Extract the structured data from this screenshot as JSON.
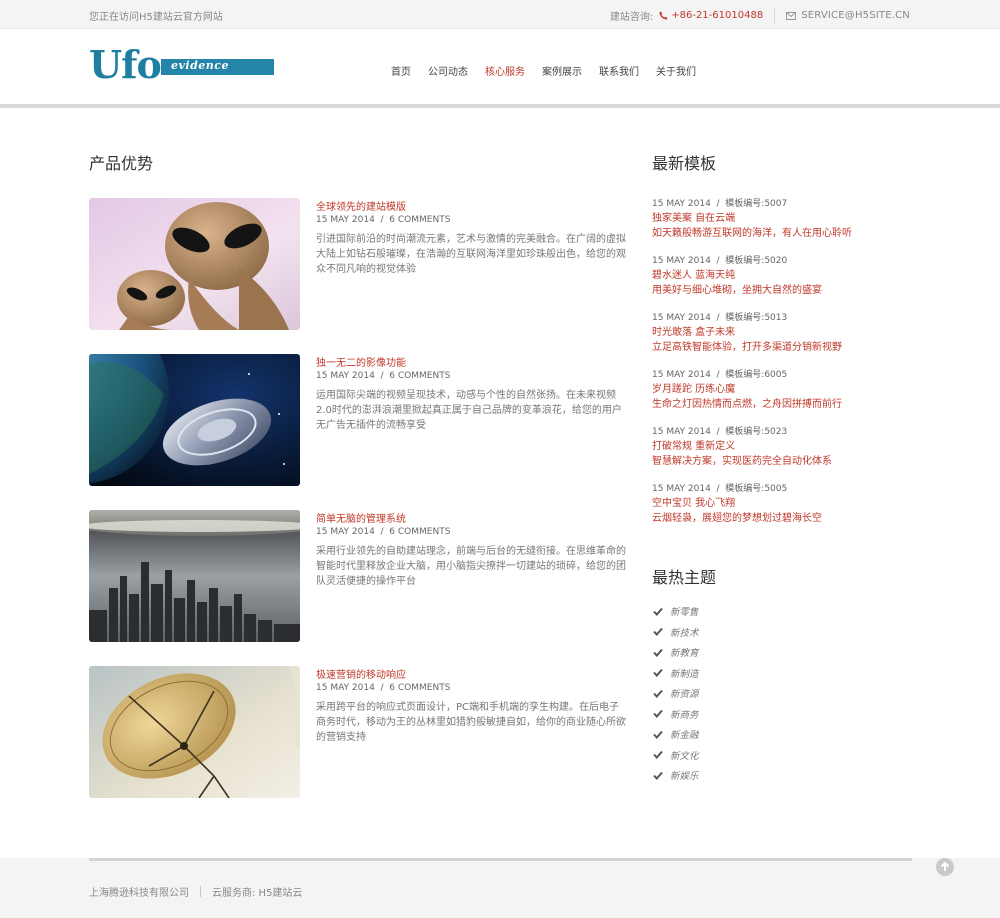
{
  "topbar": {
    "welcome": "您正在访问H5建站云官方网站",
    "consult_label": "建站咨询:",
    "phone": "+86-21-61010488",
    "email": "SERVICE@H5SITE.CN"
  },
  "logo": {
    "main": "Ufo",
    "sub": "evidence"
  },
  "nav": [
    {
      "label": "首页"
    },
    {
      "label": "公司动态"
    },
    {
      "label": "核心服务"
    },
    {
      "label": "案例展示"
    },
    {
      "label": "联系我们"
    },
    {
      "label": "关于我们"
    }
  ],
  "nav_active_index": 2,
  "products": {
    "title": "产品优势",
    "posts": [
      {
        "title": "全球领先的建站模版",
        "date": "15 MAY 2014",
        "comments": "6 COMMENTS",
        "desc": "引进国际前沿的时尚潮流元素，艺术与激情的完美融合。在广阔的虚拟大陆上如钻石般璀璨，在浩瀚的互联网海洋里如珍珠般出色，给您的观众不同凡响的视觉体验",
        "image": "alien-image"
      },
      {
        "title": "独一无二的影像功能",
        "date": "15 MAY 2014",
        "comments": "6 COMMENTS",
        "desc": "运用国际尖端的视频呈现技术，动感与个性的自然张扬。在未来视频2.0时代的澎湃浪潮里掀起真正属于自己品牌的变革浪花，给您的用户无广告无插件的流畅享受",
        "image": "ufo-space-image"
      },
      {
        "title": "简单无脑的管理系统",
        "date": "15 MAY 2014",
        "comments": "6 COMMENTS",
        "desc": "采用行业领先的自助建站理念，前端与后台的无缝衔接。在思维革命的智能时代里释放企业大脑，用小脑指尖撩拌一切建站的琐碎，给您的团队灵活便捷的操作平台",
        "image": "city-image"
      },
      {
        "title": "极速营销的移动响应",
        "date": "15 MAY 2014",
        "comments": "6 COMMENTS",
        "desc": "采用跨平台的响应式页面设计，PC端和手机端的孪生构建。在后电子商务时代，移动为王的丛林里如猎豹般敏捷自如，给你的商业随心所欲的营销支持",
        "image": "satellite-dish-image"
      }
    ]
  },
  "templates": {
    "title": "最新模板",
    "items": [
      {
        "date": "15 MAY 2014",
        "code": "模板编号:5007",
        "line1": "独家美案 自在云端",
        "line2": "如天籁般畅游互联网的海洋，有人在用心聆听"
      },
      {
        "date": "15 MAY 2014",
        "code": "模板编号:5020",
        "line1": "碧水迷人 蓝海天纯",
        "line2": "用美好与细心堆砌，坐拥大自然的盛宴"
      },
      {
        "date": "15 MAY 2014",
        "code": "模板编号:5013",
        "line1": "时光敢落 盒子未来",
        "line2": "立足高铁智能体验，打开多渠道分销新视野"
      },
      {
        "date": "15 MAY 2014",
        "code": "模板编号:6005",
        "line1": "岁月蹉跎 历练心魔",
        "line2": "生命之灯因热情而点燃，之舟因拼搏而前行"
      },
      {
        "date": "15 MAY 2014",
        "code": "模板编号:5023",
        "line1": "打破常规 重新定义",
        "line2": "智慧解决方案，实现医药完全自动化体系"
      },
      {
        "date": "15 MAY 2014",
        "code": "模板编号:5005",
        "line1": "空中宝贝 我心飞翔",
        "line2": "云烟轻袅，展翅您的梦想划过碧海长空"
      }
    ]
  },
  "topics": {
    "title": "最热主题",
    "items": [
      "新零售",
      "新技术",
      "新教育",
      "新制造",
      "新资源",
      "新商务",
      "新金融",
      "新文化",
      "新娱乐"
    ]
  },
  "footer": {
    "company": "上海腾逊科技有限公司",
    "provider": "云服务商: H5建站云"
  },
  "colors": {
    "accent": "#c0392b",
    "brand": "#1e7fa0"
  }
}
